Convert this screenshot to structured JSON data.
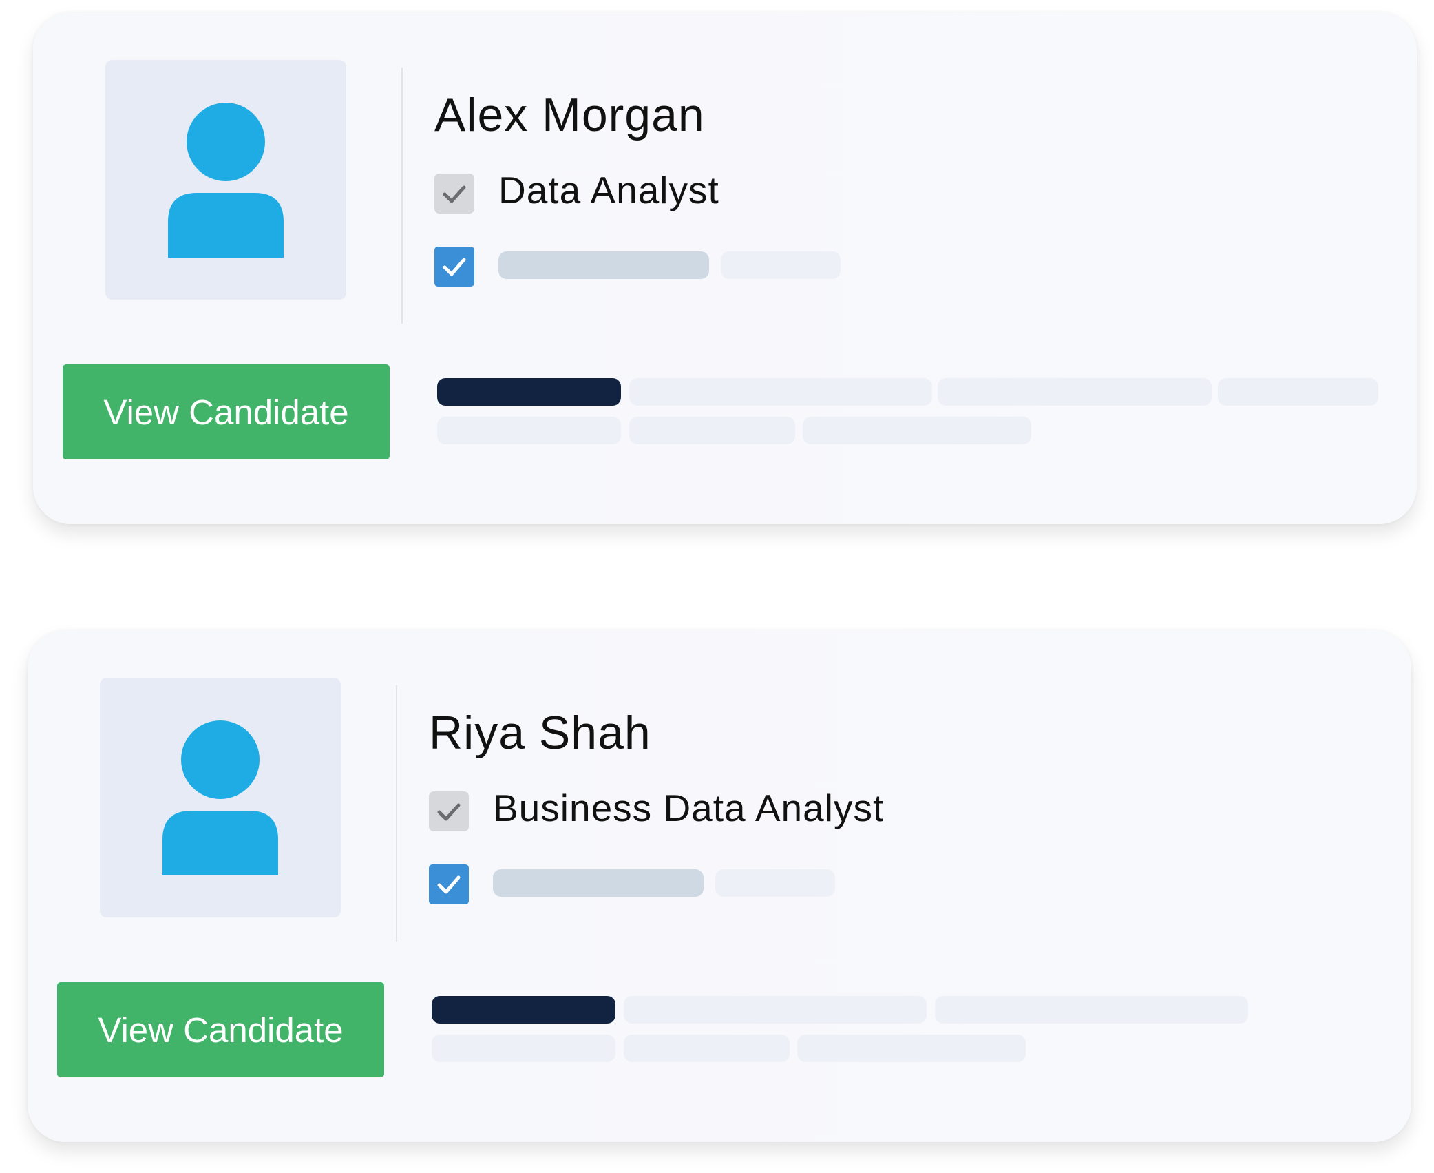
{
  "candidates": [
    {
      "name": "Alex Morgan",
      "role": "Data Analyst",
      "avatar_icon": "user-avatar-icon",
      "role_check_icon": "check-icon",
      "status_check_icon": "checkbox-checked-icon",
      "button_label": "View Candidate"
    },
    {
      "name": "Riya Shah",
      "role": "Business Data Analyst",
      "avatar_icon": "user-avatar-icon",
      "role_check_icon": "check-icon",
      "status_check_icon": "checkbox-checked-icon",
      "button_label": "View Candidate"
    }
  ],
  "colors": {
    "card_bg": "#f7f8fb",
    "avatar_bg": "#e6ebf5",
    "avatar_icon": "#1fabe3",
    "button_bg": "#41b46a",
    "button_text": "#ffffff",
    "checkbox_checked": "#3b8fd6",
    "checkbox_gray": "#d6d8dc",
    "skeleton_dark": "#112340",
    "skeleton_mid": "#ced9e4",
    "skeleton_light": "#eef0f8"
  }
}
